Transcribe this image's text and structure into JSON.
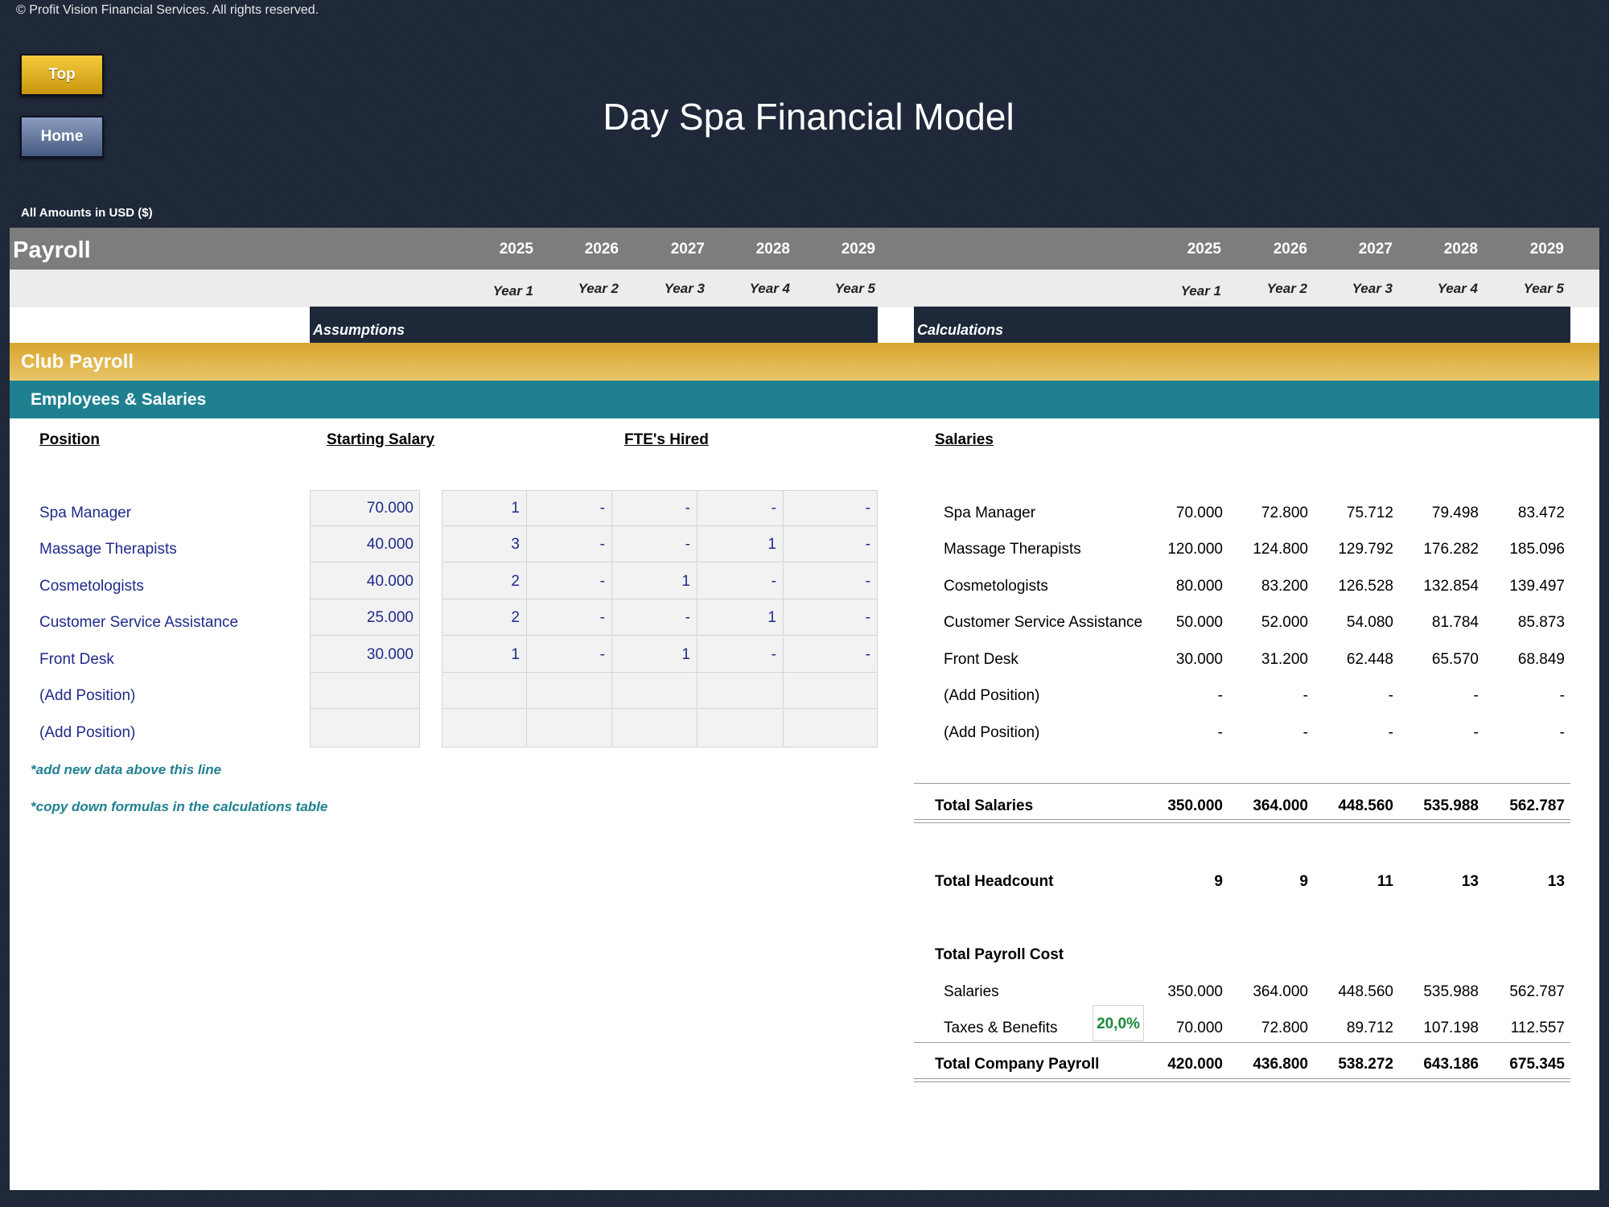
{
  "copyright": "© Profit Vision Financial Services. All rights reserved.",
  "nav": {
    "top_label": "Top",
    "home_label": "Home"
  },
  "model_title": "Day Spa Financial Model",
  "amounts_label": "All Amounts in  USD ($)",
  "sheet": {
    "title": "Payroll",
    "years": [
      "2025",
      "2026",
      "2027",
      "2028",
      "2029"
    ],
    "year_labels": [
      "Year 1",
      "Year 2",
      "Year 3",
      "Year 4",
      "Year 5"
    ],
    "assumptions_label": "Assumptions",
    "calculations_label": "Calculations",
    "section_title": "Club Payroll",
    "subsection_title": "Employees & Salaries"
  },
  "assumptions": {
    "position_header": "Position",
    "salary_header": "Starting Salary",
    "fte_header": "FTE's Hired",
    "rows": [
      {
        "position": "Spa Manager",
        "salary": "70.000",
        "fte": [
          "1",
          "-",
          "-",
          "-",
          "-"
        ]
      },
      {
        "position": "Massage Therapists",
        "salary": "40.000",
        "fte": [
          "3",
          "-",
          "-",
          "1",
          "-"
        ]
      },
      {
        "position": "Cosmetologists",
        "salary": "40.000",
        "fte": [
          "2",
          "-",
          "1",
          "-",
          "-"
        ]
      },
      {
        "position": "Customer Service Assistance",
        "salary": "25.000",
        "fte": [
          "2",
          "-",
          "-",
          "1",
          "-"
        ]
      },
      {
        "position": "Front Desk",
        "salary": "30.000",
        "fte": [
          "1",
          "-",
          "1",
          "-",
          "-"
        ]
      },
      {
        "position": "(Add Position)",
        "salary": "",
        "fte": [
          "",
          "",
          "",
          "",
          ""
        ]
      },
      {
        "position": "(Add Position)",
        "salary": "",
        "fte": [
          "",
          "",
          "",
          "",
          ""
        ]
      }
    ],
    "notes": [
      "*add new data above this line",
      "*copy down formulas in the calculations table"
    ]
  },
  "calculations": {
    "salaries_header": "Salaries",
    "rows": [
      {
        "label": "Spa Manager",
        "values": [
          "70.000",
          "72.800",
          "75.712",
          "79.498",
          "83.472"
        ]
      },
      {
        "label": "Massage Therapists",
        "values": [
          "120.000",
          "124.800",
          "129.792",
          "176.282",
          "185.096"
        ]
      },
      {
        "label": "Cosmetologists",
        "values": [
          "80.000",
          "83.200",
          "126.528",
          "132.854",
          "139.497"
        ]
      },
      {
        "label": "Customer Service Assistance",
        "values": [
          "50.000",
          "52.000",
          "54.080",
          "81.784",
          "85.873"
        ]
      },
      {
        "label": "Front Desk",
        "values": [
          "30.000",
          "31.200",
          "62.448",
          "65.570",
          "68.849"
        ]
      },
      {
        "label": "(Add Position)",
        "values": [
          "-",
          "-",
          "-",
          "-",
          "-"
        ]
      },
      {
        "label": "(Add Position)",
        "values": [
          "-",
          "-",
          "-",
          "-",
          "-"
        ]
      }
    ],
    "total_salaries": {
      "label": "Total Salaries",
      "values": [
        "350.000",
        "364.000",
        "448.560",
        "535.988",
        "562.787"
      ]
    },
    "total_headcount": {
      "label": "Total Headcount",
      "values": [
        "9",
        "9",
        "11",
        "13",
        "13"
      ]
    },
    "payroll_cost_header": "Total Payroll Cost",
    "salaries_row": {
      "label": "Salaries",
      "values": [
        "350.000",
        "364.000",
        "448.560",
        "535.988",
        "562.787"
      ]
    },
    "taxes_row": {
      "label": "Taxes & Benefits",
      "rate": "20,0%",
      "values": [
        "70.000",
        "72.800",
        "89.712",
        "107.198",
        "112.557"
      ]
    },
    "total_company_payroll": {
      "label": "Total Company Payroll",
      "values": [
        "420.000",
        "436.800",
        "538.272",
        "643.186",
        "675.345"
      ]
    }
  }
}
